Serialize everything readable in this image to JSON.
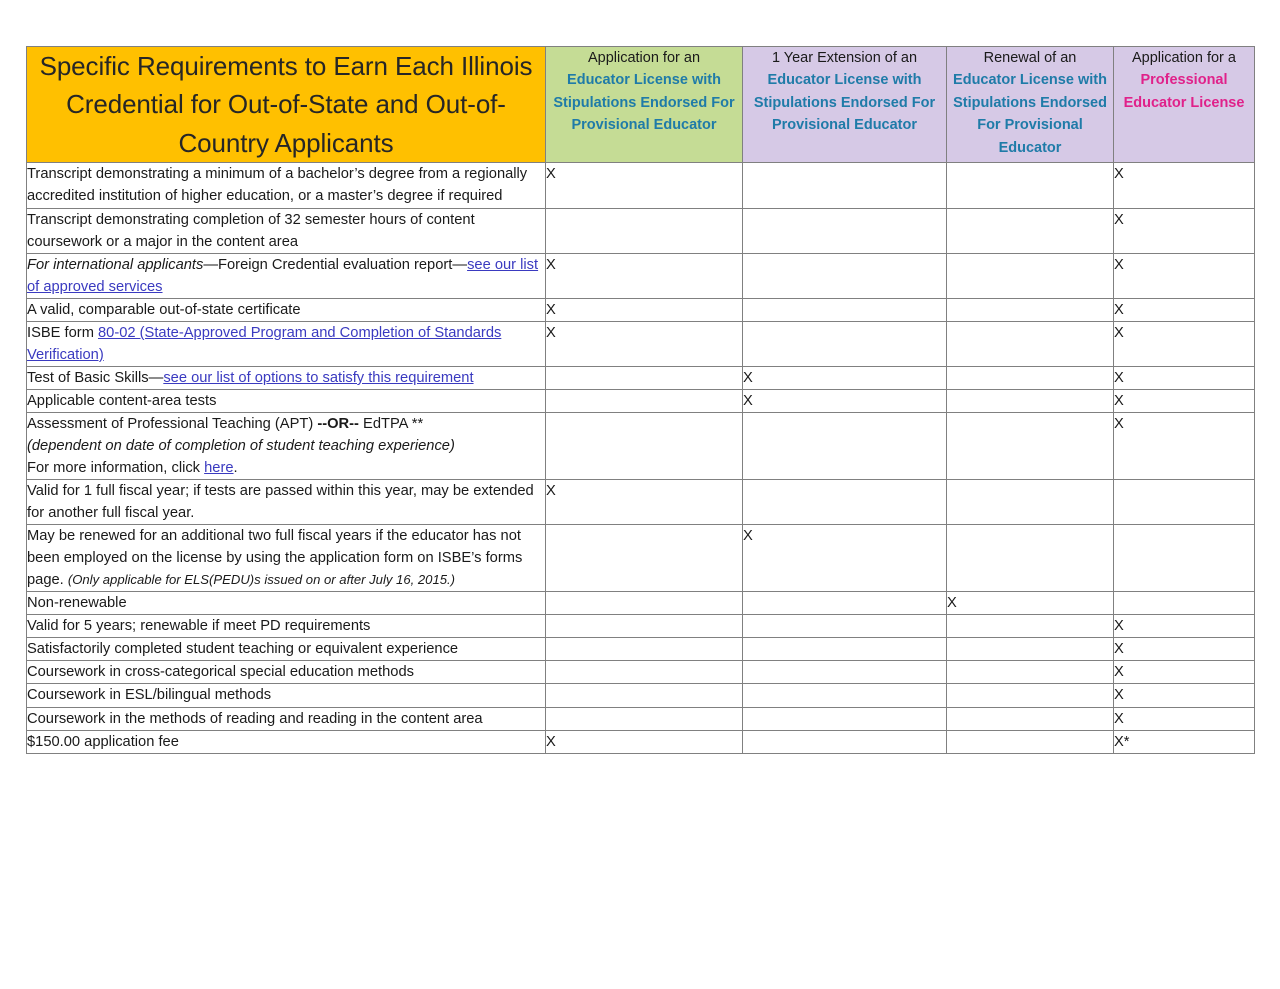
{
  "document": {
    "title": "Specific Requirements to Earn Each Illinois Credential for Out-of-State and Out-of-Country Applicants"
  },
  "colors": {
    "title_background": "#ffc000",
    "column2_background": "#c5dc95",
    "column3_background": "#d6c9e6",
    "column4_background": "#d6c9e6",
    "column5_background": "#d6c9e6",
    "heading_blue": "#1f7ba8",
    "heading_pink": "#e0218a",
    "link": "#3a3ac0",
    "border": "#808080"
  },
  "columns": [
    {
      "id": "requirement",
      "lead": "",
      "main": ""
    },
    {
      "id": "els-application",
      "lead": "Application for an",
      "main": "Educator License with Stipulations Endorsed For Provisional Educator",
      "accent": "blue"
    },
    {
      "id": "els-extension",
      "lead": "1 Year Extension of an",
      "main": "Educator License with Stipulations Endorsed For Provisional Educator",
      "accent": "blue"
    },
    {
      "id": "els-renewal",
      "lead": "Renewal of an",
      "main": "Educator License with Stipulations Endorsed For Provisional Educator",
      "accent": "blue"
    },
    {
      "id": "pel-application",
      "lead": "Application for a",
      "main": "Professional Educator License",
      "accent": "pink"
    }
  ],
  "rows": [
    {
      "id": "bachelors-transcript",
      "text": "Transcript demonstrating a minimum of a bachelor’s degree from a regionally accredited institution of higher education, or a master’s degree if required",
      "marks": [
        "X",
        "",
        "",
        "X"
      ]
    },
    {
      "id": "content-coursework-transcript",
      "text": "Transcript demonstrating completion of 32 semester hours of content coursework or a major in the content area",
      "marks": [
        "",
        "",
        "",
        "X"
      ]
    },
    {
      "id": "foreign-credential-evaluation",
      "text": "For international applicants—Foreign Credential evaluation report—see our list of approved services",
      "marks": [
        "X",
        "",
        "",
        "X"
      ]
    },
    {
      "id": "out-of-state-certificate",
      "text": "A valid, comparable out-of-state certificate",
      "marks": [
        "X",
        "",
        "",
        "X"
      ]
    },
    {
      "id": "isbe-form-80-02",
      "text": "ISBE form 80-02 (State-Approved Program and Completion of Standards Verification)",
      "marks": [
        "X",
        "",
        "",
        "X"
      ]
    },
    {
      "id": "test-of-basic-skills",
      "text": "Test of Basic Skills—see our list of options to satisfy this requirement",
      "marks": [
        "",
        "X",
        "",
        "X"
      ]
    },
    {
      "id": "content-area-tests",
      "text": "Applicable content-area tests",
      "marks": [
        "",
        "X",
        "",
        "X"
      ]
    },
    {
      "id": "apt-or-edtpa",
      "text": "Assessment of Professional Teaching (APT) --OR-- EdTPA ** (dependent on date of completion of student teaching experience) For more information, click here.",
      "marks": [
        "",
        "",
        "",
        "X"
      ]
    },
    {
      "id": "valid-one-fiscal-year",
      "text": "Valid for 1 full fiscal year; if tests are passed within this year, may be extended for another full fiscal year.",
      "marks": [
        "X",
        "",
        "",
        ""
      ]
    },
    {
      "id": "renew-two-fiscal-years",
      "text": "May be renewed for an additional two full fiscal years if the educator has not been employed on the license by using the application form on ISBE’s forms page. (Only applicable for ELS(PEDU)s issued on or after July 16, 2015.)",
      "marks": [
        "",
        "X",
        "",
        ""
      ]
    },
    {
      "id": "non-renewable",
      "text": "Non-renewable",
      "marks": [
        "",
        "",
        "X",
        ""
      ]
    },
    {
      "id": "valid-five-years",
      "text": "Valid for 5 years; renewable if meet PD requirements",
      "marks": [
        "",
        "",
        "",
        "X"
      ]
    },
    {
      "id": "student-teaching",
      "text": "Satisfactorily completed student teaching or equivalent experience",
      "marks": [
        "",
        "",
        "",
        "X"
      ]
    },
    {
      "id": "special-education-methods",
      "text": "Coursework in cross-categorical special education methods",
      "marks": [
        "",
        "",
        "",
        "X"
      ]
    },
    {
      "id": "esl-bilingual-methods",
      "text": "Coursework in ESL/bilingual methods",
      "marks": [
        "",
        "",
        "",
        "X"
      ]
    },
    {
      "id": "reading-methods",
      "text": "Coursework in the methods of reading and reading in the content area",
      "marks": [
        "",
        "",
        "",
        "X"
      ]
    },
    {
      "id": "application-fee",
      "text": "$150.00 application fee",
      "marks": [
        "X",
        "",
        "",
        "X*"
      ]
    }
  ],
  "links": [
    "see our list of approved services",
    "80-02 (State-Approved Program and Completion of Standards Verification)",
    "see our list of options to satisfy this requirement",
    "here"
  ],
  "row_fragments": {
    "foreign_credential": {
      "italic_lead": "For international applicants",
      "plain_mid": "—Foreign Credential evaluation report—",
      "link": "see our list of approved services"
    },
    "isbe_form": {
      "plain_lead": "ISBE form ",
      "link": "80-02 (State-Approved Program and Completion of Standards Verification)"
    },
    "basic_skills": {
      "plain_lead": "Test of Basic Skills—",
      "link": "see our list of options to satisfy this requirement"
    },
    "apt": {
      "line1_a": "Assessment of Professional Teaching (APT) ",
      "line1_bold": "--OR--",
      "line1_b": " EdTPA **",
      "line2_italic": "(dependent on date of completion of student teaching experience)",
      "line3_a": "For more information, click ",
      "line3_link": "here",
      "line3_b": "."
    },
    "renew_two_years": {
      "plain": "May be renewed for an additional two full fiscal years if the educator has not been employed on the license by using the application form on ISBE’s forms page. ",
      "small_italic": "(Only applicable for ELS(PEDU)s issued on or after July 16, 2015.)"
    }
  }
}
